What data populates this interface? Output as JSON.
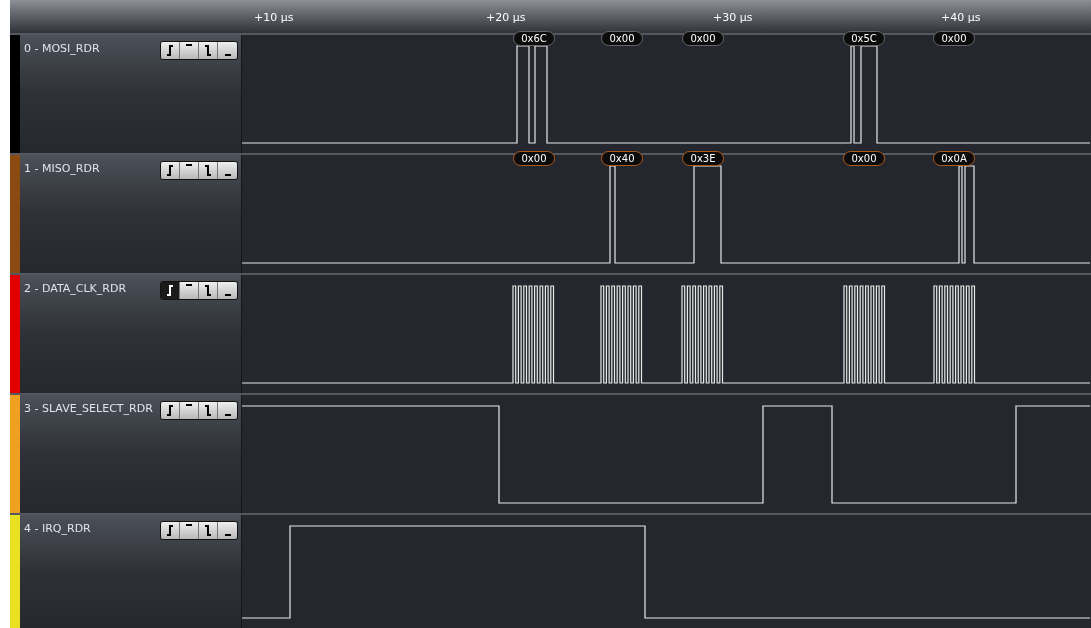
{
  "ruler": {
    "ticks": [
      "+10 µs",
      "+20 µs",
      "+30 µs",
      "+40 µs"
    ]
  },
  "channels": [
    {
      "label": "0 - MOSI_RDR",
      "color": "#000000",
      "decodes": [
        "0x6C",
        "0x00",
        "0x00",
        "0x5C",
        "0x00"
      ],
      "triggers": [
        {
          "kind": "rising",
          "selected": false
        },
        {
          "kind": "high",
          "selected": false
        },
        {
          "kind": "falling",
          "selected": false
        },
        {
          "kind": "low",
          "selected": false
        }
      ]
    },
    {
      "label": "1 - MISO_RDR",
      "color": "#8a4a10",
      "decodes": [
        "0x00",
        "0x40",
        "0x3E",
        "0x00",
        "0x0A"
      ],
      "triggers": [
        {
          "kind": "rising",
          "selected": false
        },
        {
          "kind": "high",
          "selected": false
        },
        {
          "kind": "falling",
          "selected": false
        },
        {
          "kind": "low",
          "selected": false
        }
      ]
    },
    {
      "label": "2 - DATA_CLK_RDR",
      "color": "#e00000",
      "triggers": [
        {
          "kind": "rising",
          "selected": true
        },
        {
          "kind": "high",
          "selected": false
        },
        {
          "kind": "falling",
          "selected": false
        },
        {
          "kind": "low",
          "selected": false
        }
      ]
    },
    {
      "label": "3 - SLAVE_SELECT_RDR",
      "color": "#f0a020",
      "triggers": [
        {
          "kind": "rising",
          "selected": false
        },
        {
          "kind": "high",
          "selected": false
        },
        {
          "kind": "falling",
          "selected": false
        },
        {
          "kind": "low",
          "selected": false
        }
      ]
    },
    {
      "label": "4 - IRQ_RDR",
      "color": "#e8e020",
      "triggers": [
        {
          "kind": "rising",
          "selected": false
        },
        {
          "kind": "high",
          "selected": false
        },
        {
          "kind": "falling",
          "selected": false
        },
        {
          "kind": "low",
          "selected": false
        }
      ]
    }
  ]
}
